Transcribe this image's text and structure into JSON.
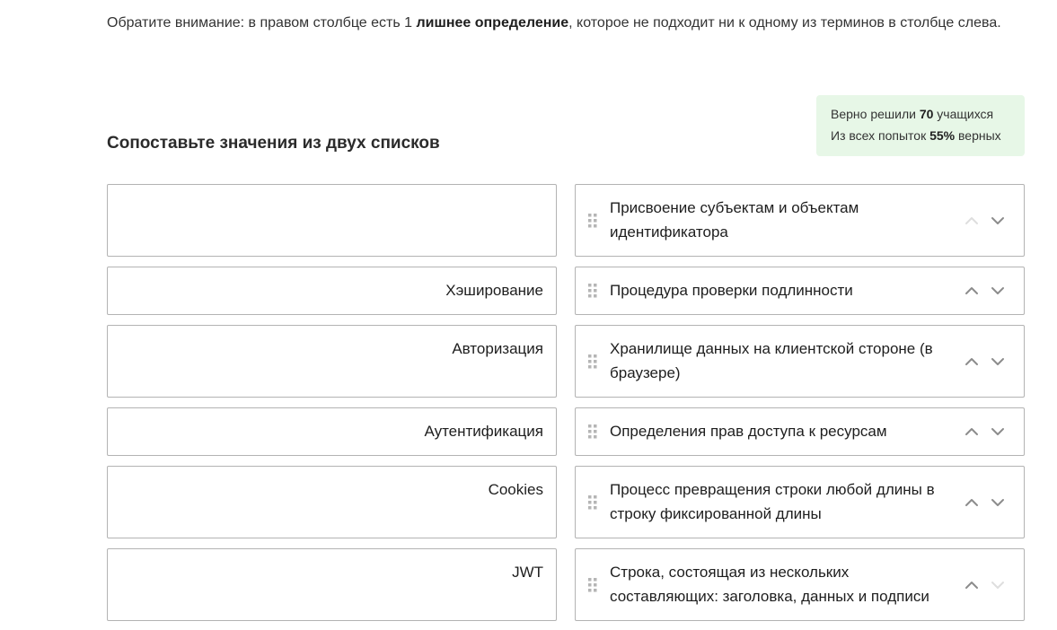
{
  "notice": {
    "text_before": "Обратите внимание: в правом столбце есть 1 ",
    "text_bold": "лишнее определение",
    "text_after": ", которое не подходит ни к одному из терминов в столбце слева."
  },
  "stats": {
    "solved_before": "Верно решили ",
    "solved_count": "70",
    "solved_after": " учащихся",
    "attempts_before": "Из всех попыток ",
    "attempts_percent": "55%",
    "attempts_after": " верных"
  },
  "task_title": "Сопоставьте значения из двух списков",
  "rows": [
    {
      "term": "",
      "definition": "Присвоение субъектам и объектам идентификатора",
      "can_move_up": false,
      "can_move_down": true
    },
    {
      "term": "Хэширование",
      "definition": "Процедура проверки подлинности",
      "can_move_up": true,
      "can_move_down": true
    },
    {
      "term": "Авторизация",
      "definition": "Хранилище данных на клиентской стороне (в браузере)",
      "can_move_up": true,
      "can_move_down": true
    },
    {
      "term": "Аутентификация",
      "definition": "Определения прав доступа к ресурсам",
      "can_move_up": true,
      "can_move_down": true
    },
    {
      "term": "Cookies",
      "definition": "Процесс превращения строки любой длины в строку фиксированной длины",
      "can_move_up": true,
      "can_move_down": true
    },
    {
      "term": "JWT",
      "definition": "Строка, состоящая из нескольких составляющих: заголовка, данных и подписи",
      "can_move_up": true,
      "can_move_down": false
    }
  ],
  "icons": {
    "drag_handle": "drag-handle-icon",
    "move_up": "chevron-up-icon",
    "move_down": "chevron-down-icon"
  },
  "colors": {
    "stats_background": "#e7f7e7",
    "border": "#b3b3b3",
    "arrow_enabled": "#8c8c8c",
    "arrow_disabled": "#dedede",
    "drag_handle": "#b5b5b5"
  }
}
